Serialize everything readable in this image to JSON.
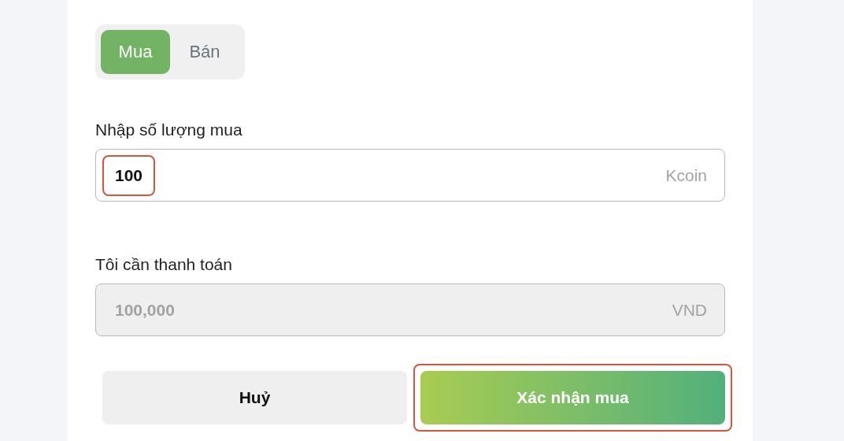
{
  "tabs": [
    {
      "label": "Mua",
      "selected": true
    },
    {
      "label": "Bán",
      "selected": false
    }
  ],
  "fields": [
    {
      "label": "Nhập số lượng mua",
      "value": "100",
      "unit": "Kcoin",
      "disabled": false,
      "highlighted": true
    },
    {
      "label": "Tôi cần thanh toán",
      "value": "100,000",
      "unit": "VND",
      "disabled": true,
      "highlighted": false
    }
  ],
  "buttons": [
    {
      "label": "Huỷ",
      "kind": "secondary",
      "highlighted": false
    },
    {
      "label": "Xác nhận mua",
      "kind": "primary",
      "highlighted": true
    }
  ]
}
